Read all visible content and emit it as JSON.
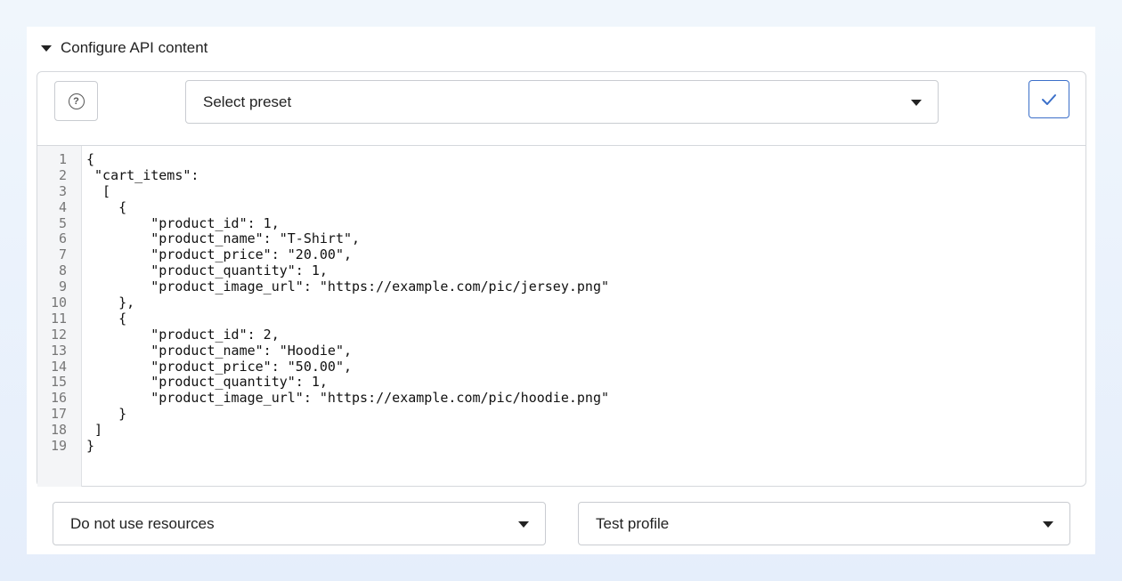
{
  "section": {
    "title": "Configure API content",
    "icon": "caret-down-icon"
  },
  "toolbar": {
    "help_icon": "question-circle-icon",
    "help_glyph": "?",
    "preset_select": {
      "value": "Select preset",
      "icon": "chevron-down-icon"
    },
    "confirm_icon": "check-icon"
  },
  "editor": {
    "lines": [
      "{",
      " \"cart_items\":",
      "  [",
      "    {",
      "        \"product_id\": 1,",
      "        \"product_name\": \"T-Shirt\",",
      "        \"product_price\": \"20.00\",",
      "        \"product_quantity\": 1,",
      "        \"product_image_url\": \"https://example.com/pic/jersey.png\"",
      "    },",
      "    {",
      "        \"product_id\": 2,",
      "        \"product_name\": \"Hoodie\",",
      "        \"product_price\": \"50.00\",",
      "        \"product_quantity\": 1,",
      "        \"product_image_url\": \"https://example.com/pic/hoodie.png\"",
      "    }",
      " ]",
      "}"
    ]
  },
  "footer": {
    "resources_select": {
      "value": "Do not use resources"
    },
    "profile_select": {
      "value": "Test profile"
    }
  },
  "colors": {
    "accent": "#3b6fc9",
    "border": "#c9ccd1",
    "gutter_bg": "#f4f5f7",
    "page_bg": "#e9f1fb"
  }
}
